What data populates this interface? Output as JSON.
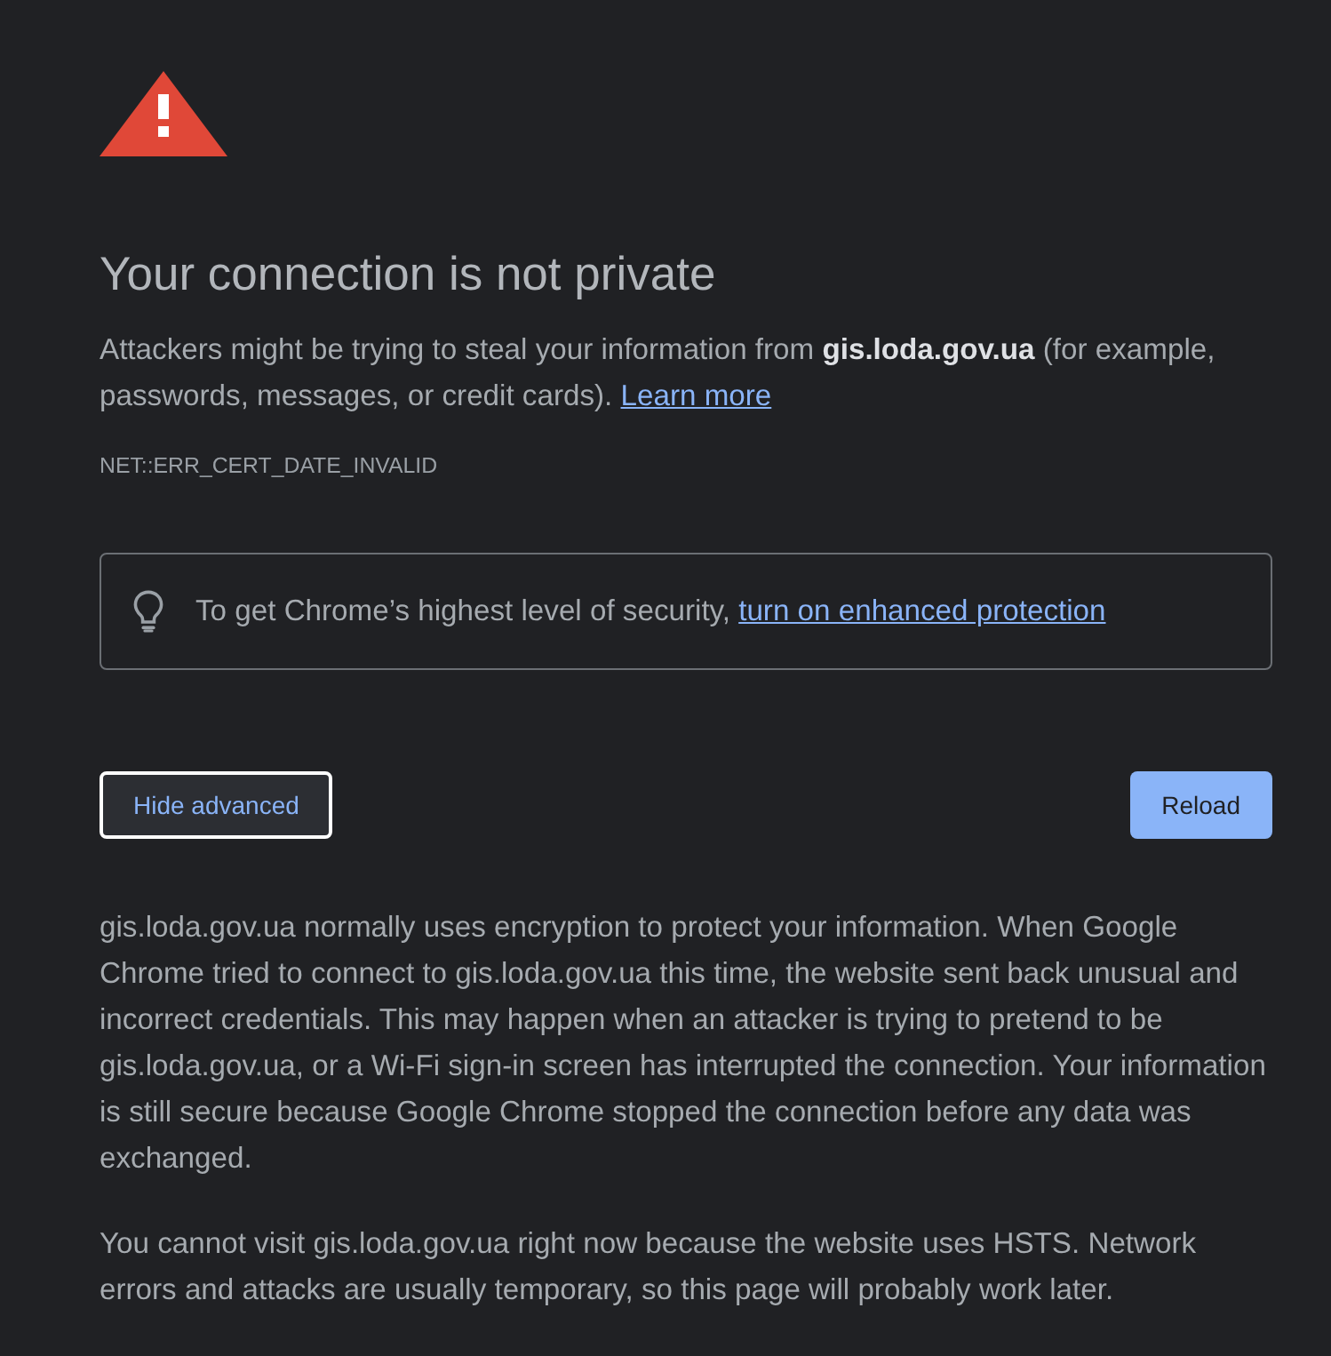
{
  "heading": "Your connection is not private",
  "explanation": {
    "text": "Attackers might be trying to steal your information from **gis.loda.gov.ua** (for example, passwords, messages, or credit cards).",
    "link": "Learn more"
  },
  "error_code": "NET::ERR_CERT_DATE_INVALID",
  "protection_tip": {
    "text": "To get Chrome’s highest level of security,",
    "link": "turn on enhanced protection"
  },
  "buttons": [
    {
      "label": "Hide advanced",
      "kind": "secondary",
      "focused": true
    },
    {
      "label": "Reload",
      "kind": "primary",
      "focused": false
    }
  ],
  "details": [
    "gis.loda.gov.ua normally uses encryption to protect your information. When Google Chrome tried to connect to gis.loda.gov.ua this time, the website sent back unusual and incorrect credentials. This may happen when an attacker is trying to pretend to be gis.loda.gov.ua, or a Wi-Fi sign-in screen has interrupted the connection. Your information is still secure because Google Chrome stopped the connection before any data was exchanged.",
    "You cannot visit gis.loda.gov.ua right now because the website uses HSTS. Network errors and attacks are usually temporary, so this page will probably work later."
  ]
}
